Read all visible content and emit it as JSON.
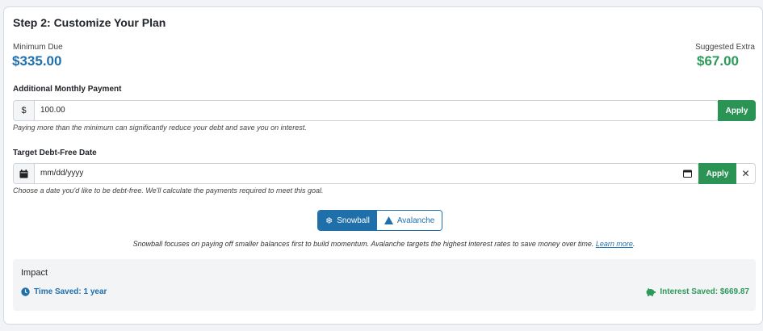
{
  "step": {
    "title": "Step 2: Customize Your Plan"
  },
  "summary": {
    "minimum_label": "Minimum Due",
    "minimum_value": "$335.00",
    "suggested_label": "Suggested Extra",
    "suggested_value": "$67.00"
  },
  "additional_payment": {
    "label": "Additional Monthly Payment",
    "currency_symbol": "$",
    "value": "100.00",
    "apply_label": "Apply",
    "help": "Paying more than the minimum can significantly reduce your debt and save you on interest."
  },
  "target_date": {
    "label": "Target Debt-Free Date",
    "placeholder": "mm/dd/yyyy",
    "apply_label": "Apply",
    "clear_label": "✕",
    "help": "Choose a date you'd like to be debt-free. We'll calculate the payments required to meet this goal."
  },
  "strategy": {
    "options": [
      {
        "label": "Snowball",
        "icon": "snowflake-icon",
        "active": true
      },
      {
        "label": "Avalanche",
        "icon": "mountain-icon",
        "active": false
      }
    ],
    "note": "Snowball focuses on paying off smaller balances first to build momentum. Avalanche targets the highest interest rates to save money over time.",
    "learn_more": "Learn more",
    "note_end": "."
  },
  "impact": {
    "title": "Impact",
    "time_saved": "Time Saved: 1 year",
    "interest_saved": "Interest Saved: $669.87"
  },
  "colors": {
    "primary": "#1f6fab",
    "success": "#2b9454",
    "success_text": "#2c9a5a"
  }
}
